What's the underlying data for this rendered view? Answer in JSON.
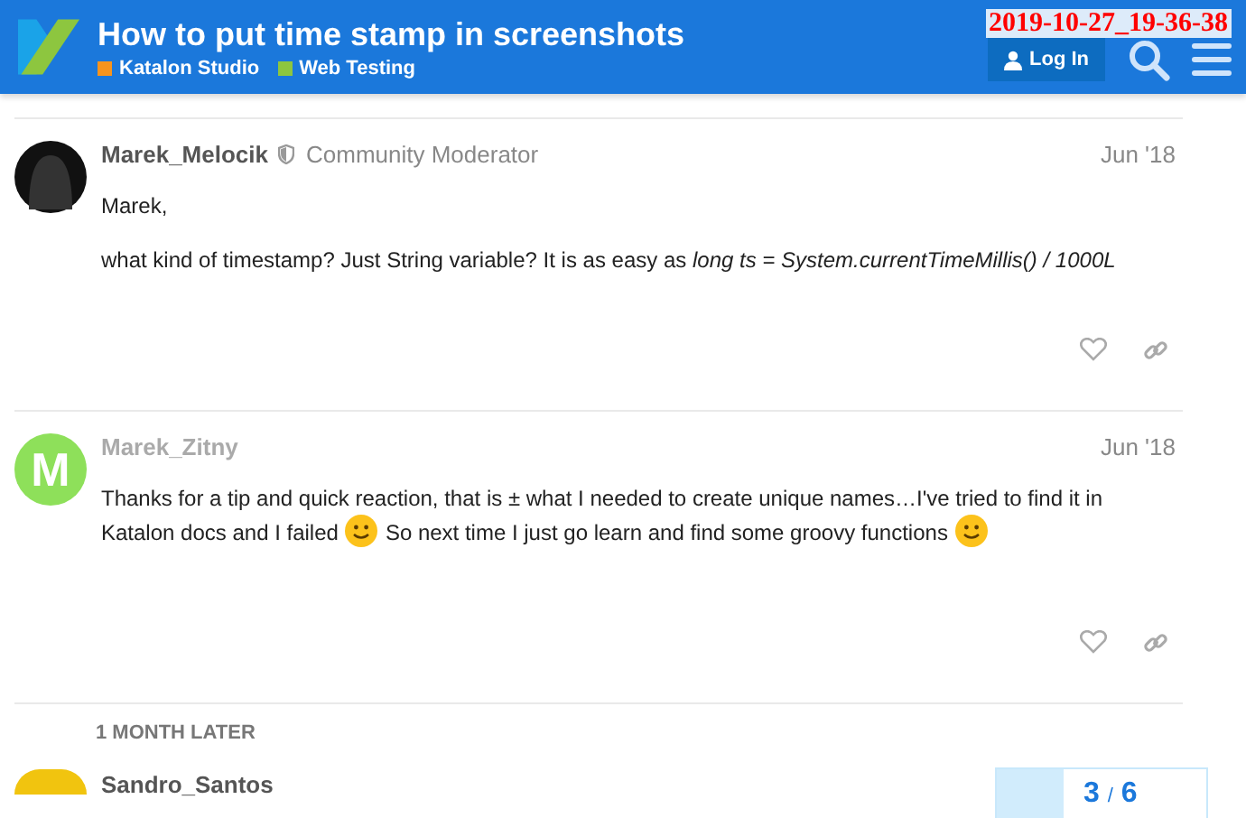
{
  "header": {
    "title": "How to put time stamp in screenshots",
    "tags": [
      {
        "label": "Katalon Studio",
        "color": "#f7941d"
      },
      {
        "label": "Web Testing",
        "color": "#8dc63f"
      }
    ],
    "login": "Log In",
    "timestamp": "2019-10-27_19-36-38"
  },
  "posts": [
    {
      "author": "Marek_Melocik",
      "dimmed": false,
      "role": "Community Moderator",
      "date": "Jun '18",
      "paragraphs": [
        [
          {
            "kind": "text",
            "text": "Marek,"
          }
        ],
        [
          {
            "kind": "text",
            "text": "what kind of timestamp? Just String variable? It is as easy as *long ts = System.currentTimeMillis() / 1000L*"
          }
        ]
      ]
    },
    {
      "author": "Marek_Zitny",
      "dimmed": true,
      "letter": "M",
      "color": "#8ee05a",
      "date": "Jun '18",
      "paragraphs": [
        [
          {
            "kind": "text",
            "text": "Thanks for a tip and quick reaction, that is ± what I needed to create unique names…I've tried to find it in"
          },
          {
            "kind": "break"
          },
          {
            "kind": "text",
            "text": "Katalon docs and I failed"
          },
          {
            "kind": "emoji"
          },
          {
            "kind": "text",
            "text": "So next time I just go learn and find some groovy functions"
          },
          {
            "kind": "emoji"
          }
        ]
      ]
    }
  ],
  "gap_label": "1 MONTH LATER",
  "next_post": {
    "author": "Sandro_Santos",
    "color": "#f1c40f"
  },
  "progress": {
    "current": "3",
    "separator": "/",
    "total": "6",
    "level": 0.32
  }
}
